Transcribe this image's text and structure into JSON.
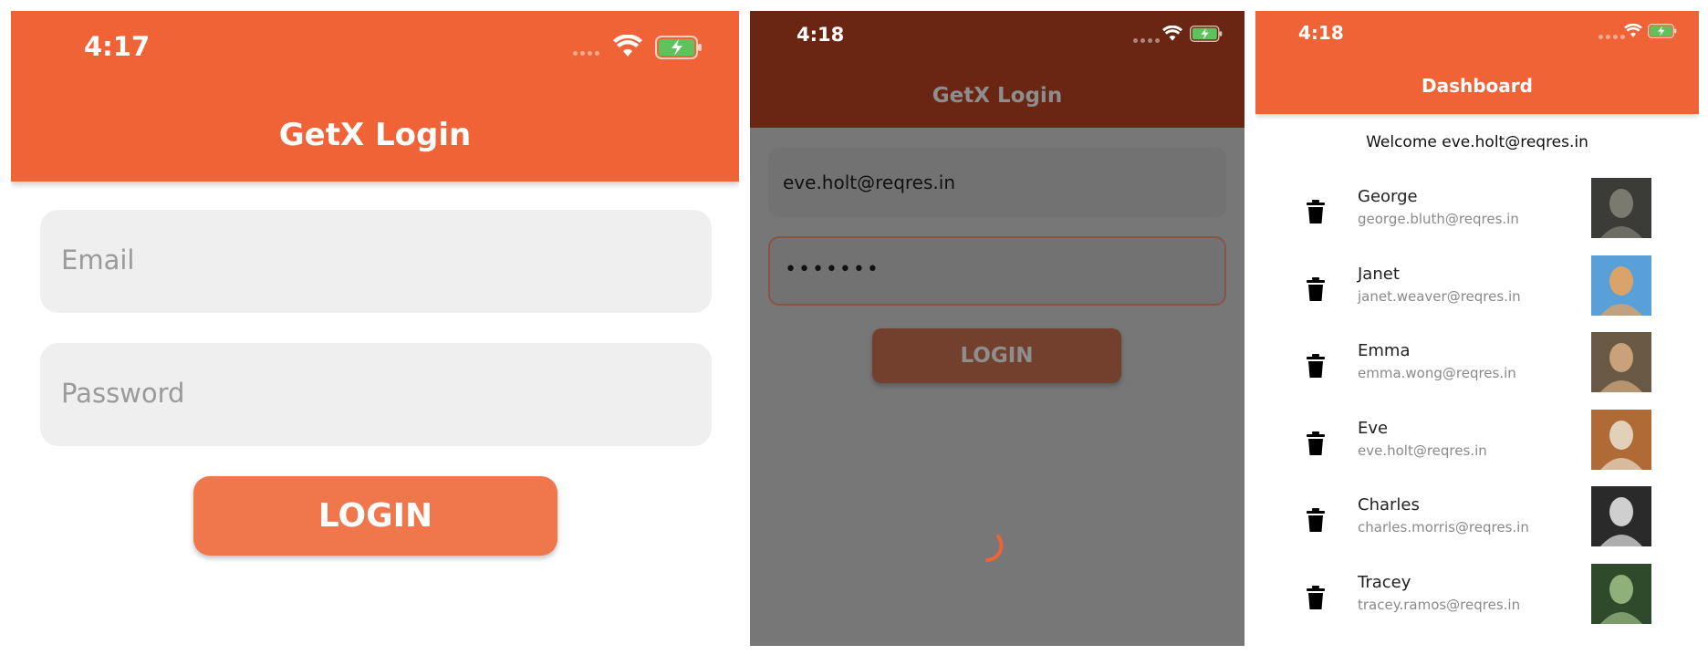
{
  "screen1": {
    "status_time": "4:17",
    "title": "GetX Login",
    "email_placeholder": "Email",
    "password_placeholder": "Password",
    "login_label": "LOGIN"
  },
  "screen2": {
    "status_time": "4:18",
    "title": "GetX Login",
    "email_value": "eve.holt@reqres.in",
    "password_value": "•••••••",
    "login_label": "LOGIN"
  },
  "screen3": {
    "status_time": "4:18",
    "title": "Dashboard",
    "welcome": "Welcome eve.holt@reqres.in",
    "users": [
      {
        "name": "George",
        "email": "george.bluth@reqres.in"
      },
      {
        "name": "Janet",
        "email": "janet.weaver@reqres.in"
      },
      {
        "name": "Emma",
        "email": "emma.wong@reqres.in"
      },
      {
        "name": "Eve",
        "email": "eve.holt@reqres.in"
      },
      {
        "name": "Charles",
        "email": "charles.morris@reqres.in"
      },
      {
        "name": "Tracey",
        "email": "tracey.ramos@reqres.in"
      }
    ]
  },
  "colors": {
    "primary": "#ef6337",
    "primary_dark_overlay": "#6b2613",
    "loading_overlay": "#777777",
    "field_bg": "#efefef"
  },
  "icons": [
    "wifi-icon",
    "battery-charging-icon",
    "trash-icon",
    "loading-spinner"
  ]
}
